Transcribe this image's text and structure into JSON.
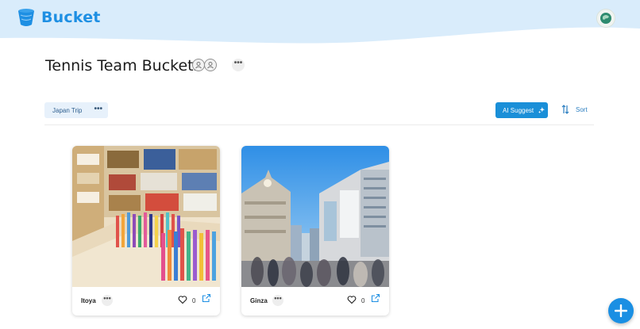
{
  "app": {
    "name": "Bucket"
  },
  "page": {
    "title": "Tennis Team Buckets",
    "more_label": "•••"
  },
  "toolbar": {
    "filter_chip": "Japan Trip",
    "chip_more": "•••",
    "ai_suggest": "AI Suggest",
    "sort": "Sort"
  },
  "cards": [
    {
      "name": "Itoya",
      "more": "•••",
      "likes": "0"
    },
    {
      "name": "Ginza",
      "more": "•••",
      "likes": "0"
    }
  ],
  "colors": {
    "brand": "#1e8fe3",
    "accent_button": "#1a8fd8",
    "header_bg": "#d9ecfb"
  },
  "icons": [
    "bucket-logo-icon",
    "user-avatar-icon",
    "member-icon",
    "sparkle-icon",
    "sort-arrows-icon",
    "heart-icon",
    "open-external-icon",
    "plus-icon"
  ]
}
